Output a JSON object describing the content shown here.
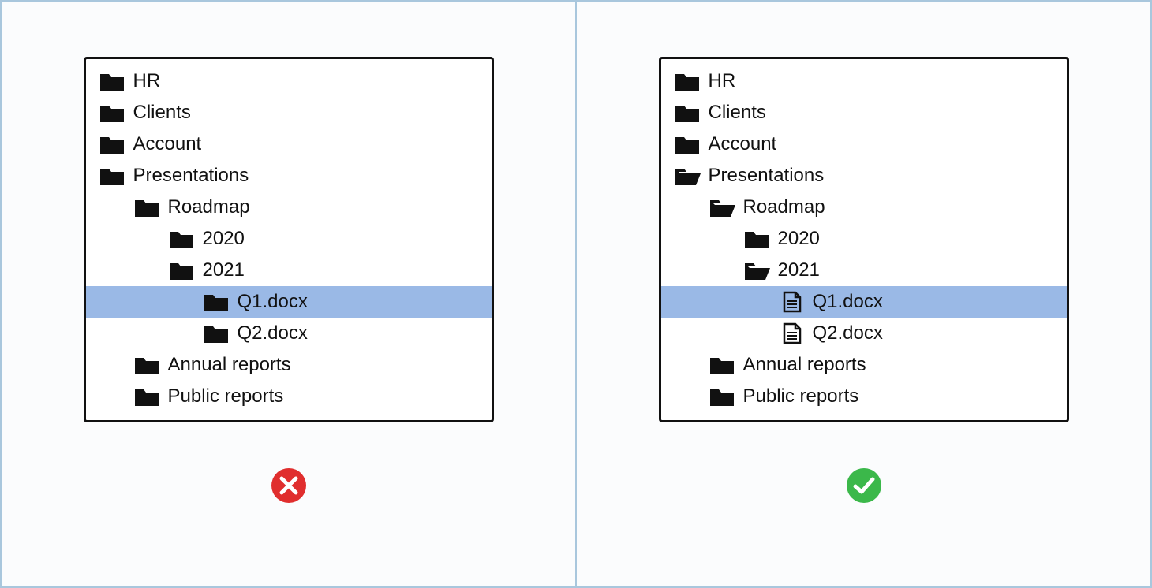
{
  "panels": {
    "left": {
      "status": "bad",
      "items": [
        {
          "label": "HR",
          "icon": "folder-closed",
          "indent": 0,
          "selected": false
        },
        {
          "label": "Clients",
          "icon": "folder-closed",
          "indent": 0,
          "selected": false
        },
        {
          "label": "Account",
          "icon": "folder-closed",
          "indent": 0,
          "selected": false
        },
        {
          "label": "Presentations",
          "icon": "folder-closed",
          "indent": 0,
          "selected": false
        },
        {
          "label": "Roadmap",
          "icon": "folder-closed",
          "indent": 1,
          "selected": false
        },
        {
          "label": "2020",
          "icon": "folder-closed",
          "indent": 2,
          "selected": false
        },
        {
          "label": "2021",
          "icon": "folder-closed",
          "indent": 2,
          "selected": false
        },
        {
          "label": "Q1.docx",
          "icon": "folder-closed",
          "indent": 3,
          "selected": true
        },
        {
          "label": "Q2.docx",
          "icon": "folder-closed",
          "indent": 3,
          "selected": false
        },
        {
          "label": "Annual reports",
          "icon": "folder-closed",
          "indent": 1,
          "selected": false
        },
        {
          "label": "Public reports",
          "icon": "folder-closed",
          "indent": 1,
          "selected": false
        }
      ]
    },
    "right": {
      "status": "good",
      "items": [
        {
          "label": "HR",
          "icon": "folder-closed",
          "indent": 0,
          "selected": false
        },
        {
          "label": "Clients",
          "icon": "folder-closed",
          "indent": 0,
          "selected": false
        },
        {
          "label": "Account",
          "icon": "folder-closed",
          "indent": 0,
          "selected": false
        },
        {
          "label": "Presentations",
          "icon": "folder-open",
          "indent": 0,
          "selected": false
        },
        {
          "label": "Roadmap",
          "icon": "folder-open",
          "indent": 1,
          "selected": false
        },
        {
          "label": "2020",
          "icon": "folder-closed",
          "indent": 2,
          "selected": false
        },
        {
          "label": "2021",
          "icon": "folder-open",
          "indent": 2,
          "selected": false
        },
        {
          "label": "Q1.docx",
          "icon": "file",
          "indent": 3,
          "selected": true
        },
        {
          "label": "Q2.docx",
          "icon": "file",
          "indent": 3,
          "selected": false
        },
        {
          "label": "Annual reports",
          "icon": "folder-closed",
          "indent": 1,
          "selected": false
        },
        {
          "label": "Public reports",
          "icon": "folder-closed",
          "indent": 1,
          "selected": false
        }
      ]
    }
  },
  "colors": {
    "highlight": "#9ab9e6",
    "border": "#a9c7dd",
    "bad": "#e02e2e",
    "good": "#3bb84a"
  }
}
